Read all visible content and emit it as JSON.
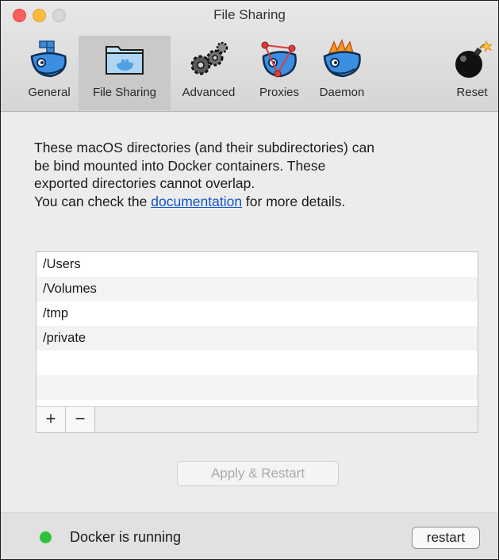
{
  "window": {
    "title": "File Sharing"
  },
  "toolbar": {
    "tabs": [
      {
        "label": "General",
        "icon": "docker-whale-icon"
      },
      {
        "label": "File Sharing",
        "icon": "folder-icon",
        "selected": true
      },
      {
        "label": "Advanced",
        "icon": "gears-icon"
      },
      {
        "label": "Proxies",
        "icon": "proxies-whale-icon"
      },
      {
        "label": "Daemon",
        "icon": "daemon-whale-icon"
      },
      {
        "label": "Reset",
        "icon": "bomb-icon"
      }
    ]
  },
  "description": {
    "line1": "These macOS directories (and their subdirectories) can",
    "line2": "be bind mounted into Docker containers. These",
    "line3": "exported directories cannot overlap.",
    "line4_before": "You can check the ",
    "link": "documentation",
    "line4_after": " for more details."
  },
  "directories": [
    "/Users",
    "/Volumes",
    "/tmp",
    "/private"
  ],
  "list_buttons": {
    "add": "+",
    "remove": "−"
  },
  "apply_button": "Apply & Restart",
  "status": {
    "text": "Docker is running",
    "color": "#2ec23b",
    "restart_label": "restart"
  }
}
